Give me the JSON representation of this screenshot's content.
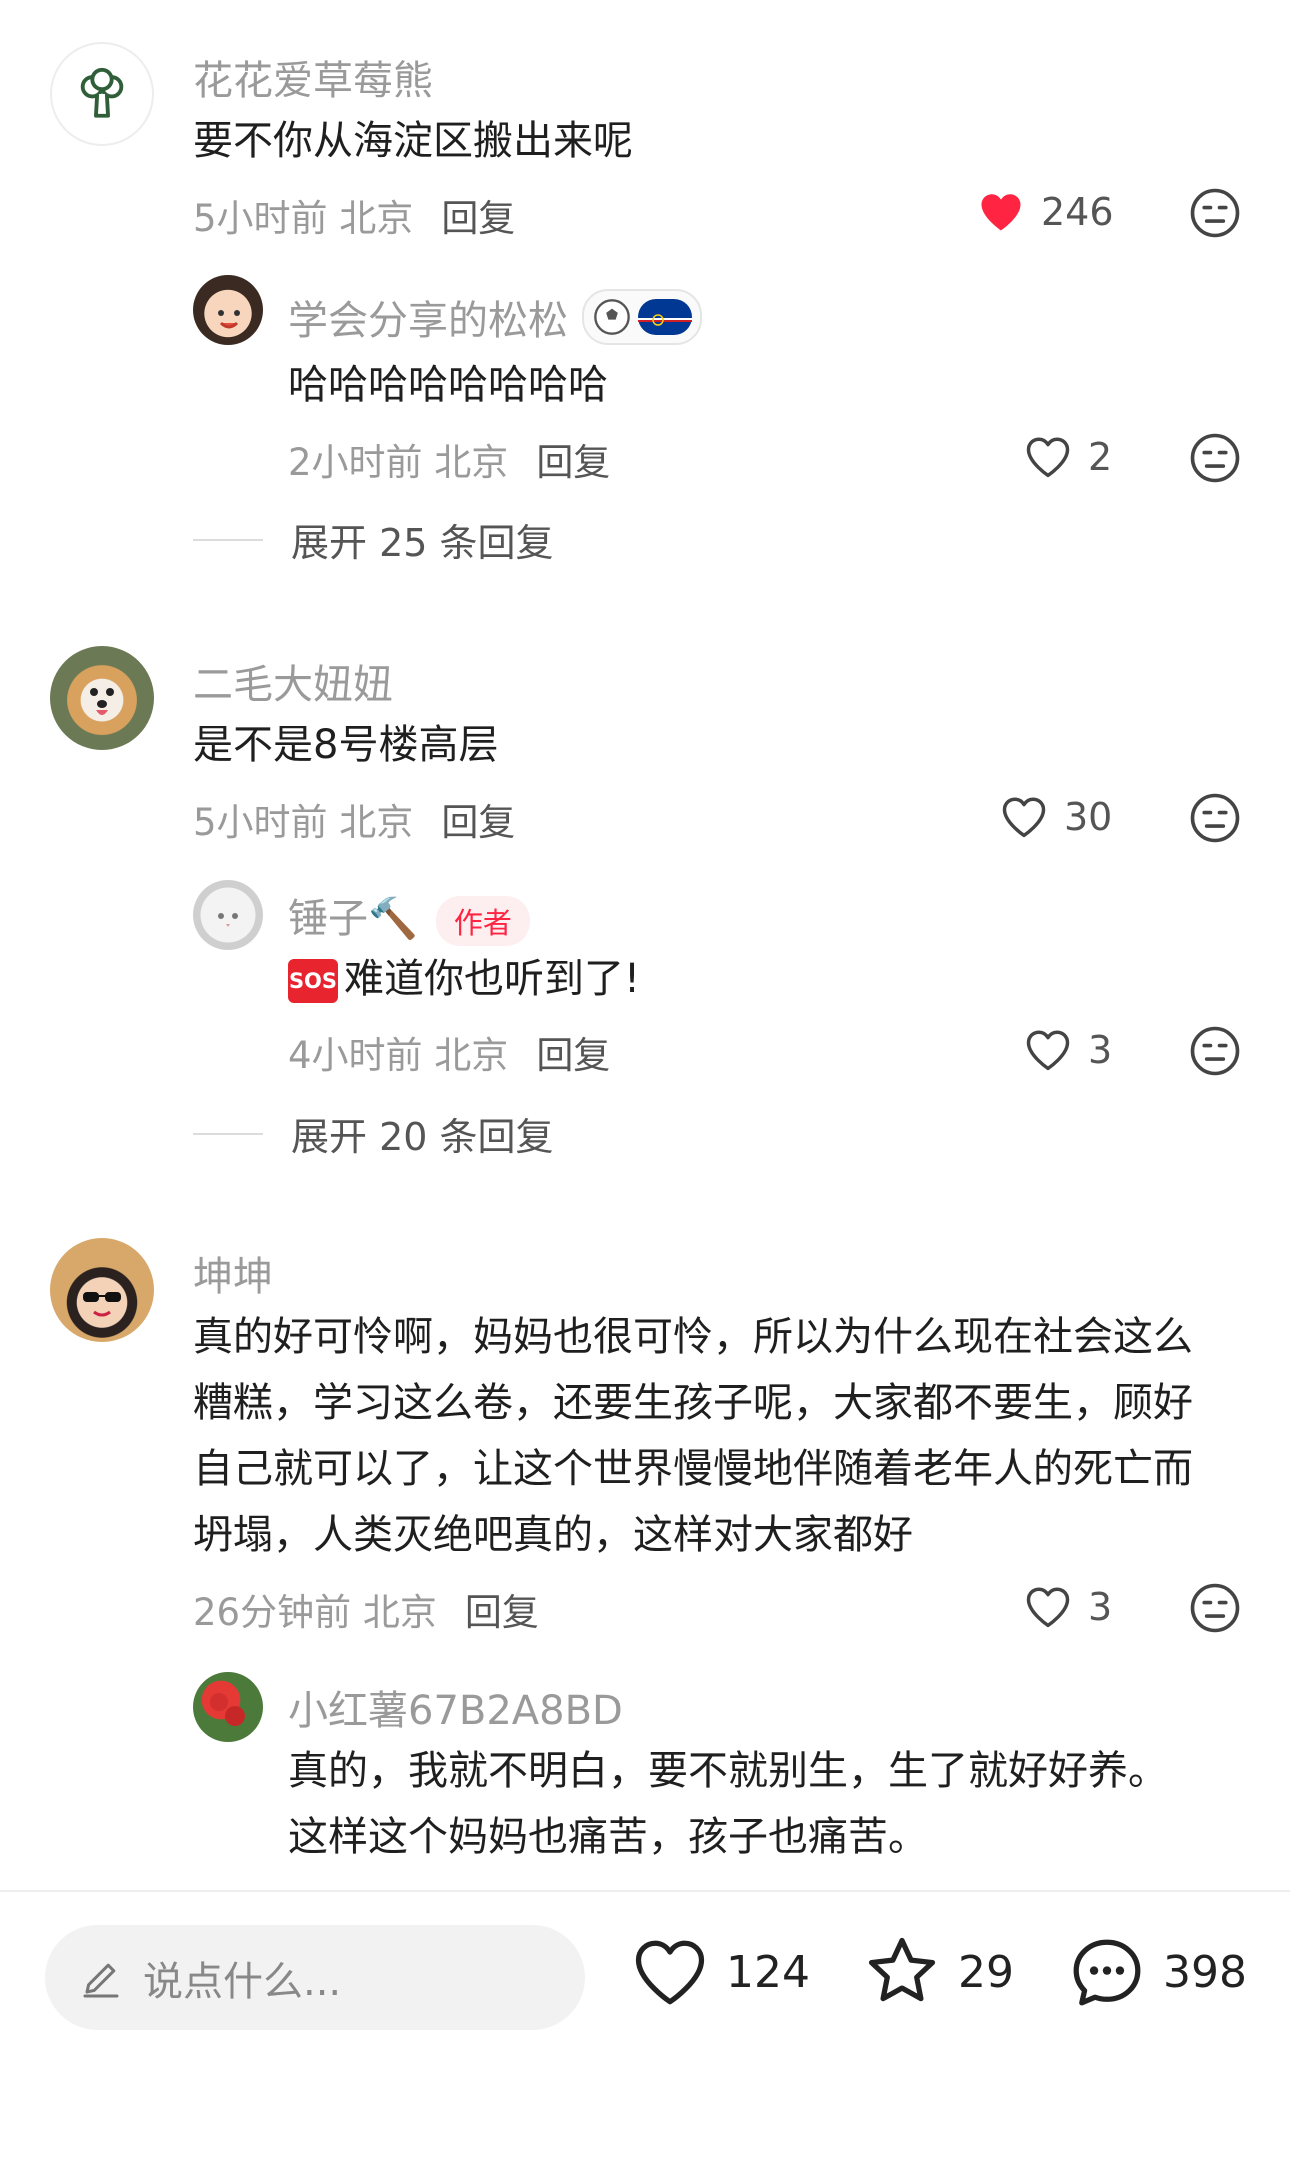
{
  "comments": [
    {
      "username": "花花爱草莓熊",
      "text": "要不你从海淀区搬出来呢",
      "time_location": "5小时前 北京",
      "reply_label": "回复",
      "likes": "246",
      "reply": {
        "username": "学会分享的松松",
        "text": "哈哈哈哈哈哈哈哈",
        "time_location": "2小时前 北京",
        "reply_label": "回复",
        "likes": "2"
      },
      "expand_label": "展开 25 条回复"
    },
    {
      "username": "二毛大妞妞",
      "text": "是不是8号楼高层",
      "time_location": "5小时前 北京",
      "reply_label": "回复",
      "likes": "30",
      "reply": {
        "username": "锤子🔨",
        "author_tag": "作者",
        "sos": "SOS",
        "text": "难道你也听到了!",
        "time_location": "4小时前 北京",
        "reply_label": "回复",
        "likes": "3"
      },
      "expand_label": "展开 20 条回复"
    },
    {
      "username": "坤坤",
      "text_lines": [
        "真的好可怜啊，妈妈也很可怜，所以为什么现在社会这么",
        "糟糕，学习这么卷，还要生孩子呢，大家都不要生，顾好",
        "自己就可以了，让这个世界慢慢地伴随着老年人的死亡而",
        "坍塌，人类灭绝吧真的，这样对大家都好"
      ],
      "time_location": "26分钟前 北京",
      "reply_label": "回复",
      "likes": "3",
      "reply": {
        "username": "小红薯67B2A8BD",
        "text_lines": [
          "真的，我就不明白，要不就别生，生了就好好养。",
          "这样这个妈妈也痛苦，孩子也痛苦。"
        ]
      }
    }
  ],
  "bottom_bar": {
    "input_placeholder": "说点什么...",
    "likes": "124",
    "favorites": "29",
    "comments": "398"
  },
  "colors": {
    "liked_heart": "#ff2442",
    "author_tag": "#ff2442"
  }
}
